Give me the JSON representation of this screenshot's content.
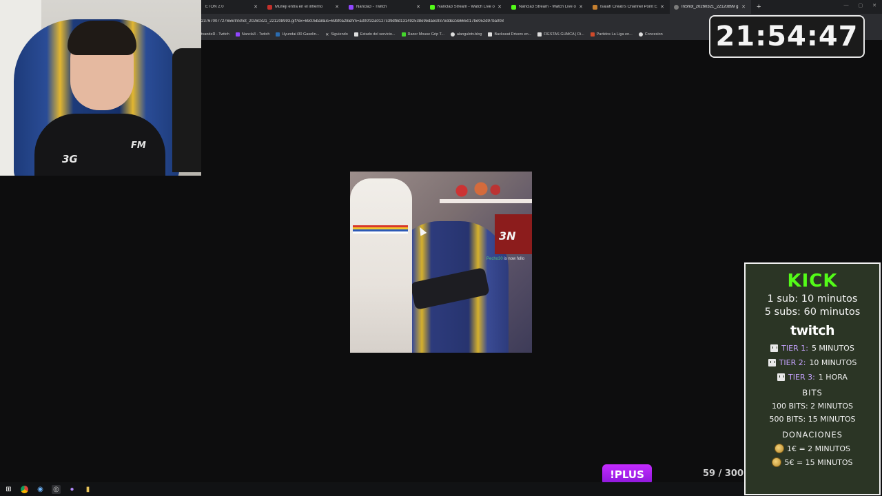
{
  "browser": {
    "tabs": [
      {
        "label": "ETON 2.0",
        "favicon_color": "#555555"
      },
      {
        "label": "Murieji entra en el infierno",
        "favicon_color": "#c4302b"
      },
      {
        "label": "Nancla3 - Twitch",
        "favicon_color": "#9146ff"
      },
      {
        "label": "Nancla3 Stream - Watch Live o",
        "favicon_color": "#53fc18"
      },
      {
        "label": "Nancla3 Stream - Watch Live o",
        "favicon_color": "#53fc18"
      },
      {
        "label": "Isaiah Creati's Channel Point E",
        "favicon_color": "#c57f2f"
      },
      {
        "label": "InShot_20260321_22120899 g",
        "favicon_color": "#7c7c7c"
      }
    ],
    "url": "23767007727656/InShot_20260321_221208993.gif?ex=69c05ba8&is=69bf0a28&hm=a300f32a0127c39df8d131492538e9edaec937edde23e665017be052d97ba008",
    "bookmarks": [
      {
        "label": "tvandeR - Twitch",
        "color": "#9146ff"
      },
      {
        "label": "Nancla3 - Twitch",
        "color": "#9146ff"
      },
      {
        "label": "Hyundai i30 Gasolin...",
        "color": "#2b6cb0"
      },
      {
        "label": "Siguiendo",
        "color": "#dddddd"
      },
      {
        "label": "Estado del servicio...",
        "color": "#dddddd"
      },
      {
        "label": "Razer Mouse Grip T...",
        "color": "#44d62c"
      },
      {
        "label": "alangulotv.blog",
        "color": "#dddddd"
      },
      {
        "label": "Backseat Drivers en...",
        "color": "#dddddd"
      },
      {
        "label": "FIESTAS GUMCA | Di...",
        "color": "#dddddd"
      },
      {
        "label": "Partidos La Liga en...",
        "color": "#d04a2a"
      },
      {
        "label": "Concesion",
        "color": "#dddddd"
      }
    ]
  },
  "webcam": {
    "jersey_logo": "3G",
    "sponsor_logo": "FM"
  },
  "clock": "21:54:47",
  "gif": {
    "poster_text": "3N",
    "follow_name": "Pecho30",
    "follow_text": "is now follo"
  },
  "subathon": {
    "kick_title": "KICK",
    "kick_lines": [
      "1 sub: 10 minutos",
      "5 subs: 60 minutos"
    ],
    "twitch_title": "twitch",
    "tiers": [
      {
        "label": "TIER 1:",
        "value": "5 MINUTOS"
      },
      {
        "label": "TIER 2:",
        "value": "10 MINUTOS"
      },
      {
        "label": "TIER 3:",
        "value": "1 HORA"
      }
    ],
    "bits_title": "BITS",
    "bits_lines": [
      "100 BITS: 2 MINUTOS",
      "500 BITS: 15 MINUTOS"
    ],
    "donations_title": "DONACIONES",
    "donation_lines": [
      "1€ = 2 MINUTOS",
      "5€ = 15 MINUTOS"
    ]
  },
  "plus_command": "!PLUS",
  "counter": "59 / 300"
}
